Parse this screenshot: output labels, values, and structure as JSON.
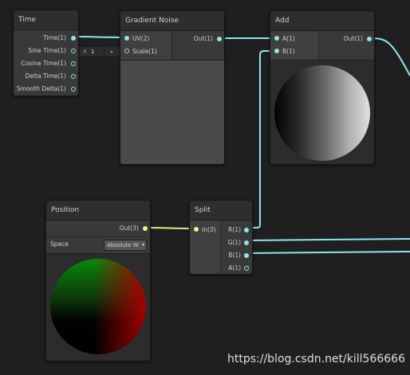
{
  "colors": {
    "wire_cyan": "#8de6ec",
    "wire_yellow": "#e6e38a"
  },
  "time_node": {
    "title": "Time",
    "outputs": [
      "Time(1)",
      "Sine Time(1)",
      "Cosine Time(1)",
      "Delta Time(1)",
      "Smooth Delta(1)"
    ]
  },
  "gradient_node": {
    "title": "Gradient Noise",
    "inputs": [
      "UV(2)",
      "Scale(1)"
    ],
    "output": "Out(1)",
    "scale_field_prefix": "X",
    "scale_field_value": "1"
  },
  "add_node": {
    "title": "Add",
    "inputs": [
      "A(1)",
      "B(1)"
    ],
    "output": "Out(1)"
  },
  "position_node": {
    "title": "Position",
    "output": "Out(3)",
    "space_label": "Space",
    "space_value": "Absolute W"
  },
  "split_node": {
    "title": "Split",
    "input": "In(3)",
    "outputs": [
      "R(1)",
      "G(1)",
      "B(1)",
      "A(1)"
    ]
  },
  "watermark": "https://blog.csdn.net/kill566666"
}
